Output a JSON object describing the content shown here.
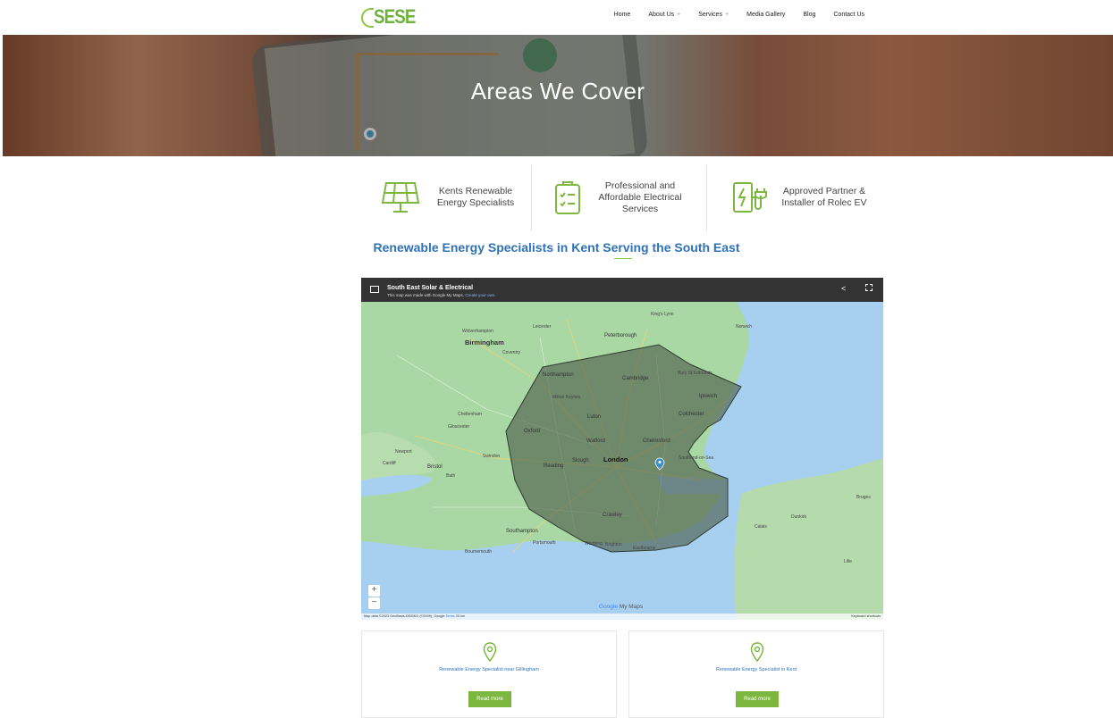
{
  "header": {
    "logo_text": "SESE",
    "nav": [
      {
        "label": "Home",
        "has_submenu": false
      },
      {
        "label": "About Us",
        "has_submenu": true
      },
      {
        "label": "Services",
        "has_submenu": true
      },
      {
        "label": "Media Gallery",
        "has_submenu": false
      },
      {
        "label": "Blog",
        "has_submenu": false
      },
      {
        "label": "Contact Us",
        "has_submenu": false
      }
    ],
    "submenu_marker": "+"
  },
  "hero": {
    "title": "Areas We Cover"
  },
  "features": [
    {
      "icon": "solar-panel-icon",
      "text": "Kents Renewable Energy Specialists"
    },
    {
      "icon": "clipboard-checklist-icon",
      "text": "Professional and Affordable Electrical Services"
    },
    {
      "icon": "ev-charger-icon",
      "text": "Approved Partner & Installer of Rolec EV"
    }
  ],
  "section_heading": "Renewable Energy Specialists in Kent Serving the South East",
  "map": {
    "title": "South East Solar & Electrical",
    "subtitle": "This map was made with Google My Maps.",
    "subtitle_link": "Create your own.",
    "zoom_in": "+",
    "zoom_out": "−",
    "footer": "Map data ©2023 GeoBasis-DE/BKG (©2009), Google",
    "terms": "Terms",
    "scale": "20 km",
    "keyboard": "Keyboard shortcuts",
    "brand_google": "Google",
    "brand_mymaps": "My Maps",
    "labels": {
      "birmingham": "Birmingham",
      "london": "London",
      "northampton": "Northampton",
      "cambridge": "Cambridge",
      "oxford": "Oxford",
      "reading": "Reading",
      "slough": "Slough",
      "chelmsford": "Chelmsford",
      "colchester": "Colchester",
      "ipswich": "Ipswich",
      "luton": "Luton",
      "watford": "Watford",
      "crawley": "Crawley",
      "southampton": "Southampton",
      "portsmouth": "Portsmouth",
      "bristol": "Bristol",
      "cardiff": "Cardiff",
      "gloucester": "Gloucester",
      "swindon": "Swindon",
      "peterborough": "Peterborough",
      "leicester": "Leicester",
      "norwich": "Norwich",
      "bournemouth": "Bournemouth",
      "bruges": "Bruges",
      "calais": "Calais",
      "dunkirk": "Dunkirk",
      "lille": "Lille",
      "cheltenham": "Cheltenham",
      "wolverhampton": "Wolverhampton",
      "coventry": "Coventry",
      "newport": "Newport",
      "bath": "Bath",
      "brighton": "Brighton",
      "southend": "Southend-on-Sea",
      "kings_lynn": "King's Lynn",
      "bury": "Bury St Edmunds",
      "milton_keynes": "Milton Keynes",
      "worthing": "Worthing",
      "eastbourne": "Eastbourne"
    }
  },
  "cards": [
    {
      "title": "Renewable Energy Specialist near Gillingham",
      "button": "Read more"
    },
    {
      "title": "Renewable Energy Specialist in Kent",
      "button": "Read more"
    }
  ],
  "colors": {
    "brand_green": "#7cb83f",
    "link_blue": "#2f72b7",
    "map_bar": "#333333",
    "coverage_fill": "#4a5a48"
  }
}
